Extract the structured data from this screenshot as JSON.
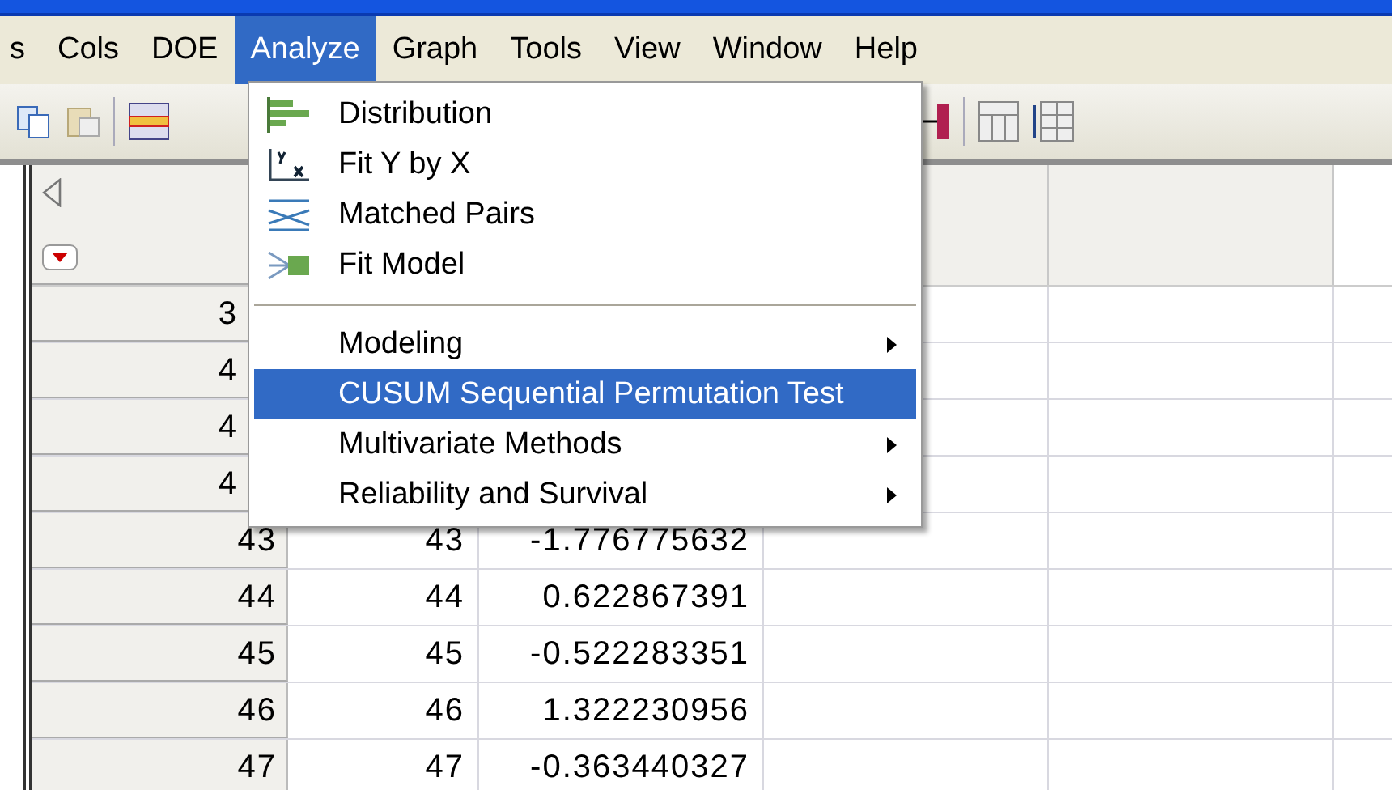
{
  "menubar": [
    {
      "label": "s",
      "selected": false
    },
    {
      "label": "Cols",
      "selected": false
    },
    {
      "label": "DOE",
      "selected": false
    },
    {
      "label": "Analyze",
      "selected": true
    },
    {
      "label": "Graph",
      "selected": false
    },
    {
      "label": "Tools",
      "selected": false
    },
    {
      "label": "View",
      "selected": false
    },
    {
      "label": "Window",
      "selected": false
    },
    {
      "label": "Help",
      "selected": false
    }
  ],
  "menu": {
    "items": [
      {
        "kind": "tool",
        "label": "Distribution",
        "selected": false
      },
      {
        "kind": "tool",
        "label": "Fit Y by X",
        "selected": false
      },
      {
        "kind": "tool",
        "label": "Matched Pairs",
        "selected": false
      },
      {
        "kind": "tool",
        "label": "Fit Model",
        "selected": false
      },
      {
        "kind": "separator"
      },
      {
        "kind": "submenu",
        "label": "Modeling",
        "selected": false
      },
      {
        "kind": "item",
        "label": "CUSUM Sequential Permutation Test",
        "selected": true
      },
      {
        "kind": "submenu",
        "label": "Multivariate Methods",
        "selected": false
      },
      {
        "kind": "submenu",
        "label": "Reliability and Survival",
        "selected": false
      }
    ]
  },
  "table": {
    "rows": [
      {
        "row": "3",
        "covered": true
      },
      {
        "row": "4",
        "covered": true
      },
      {
        "row": "4",
        "covered": true
      },
      {
        "row": "4",
        "covered": true
      },
      {
        "row": "43",
        "covered": false,
        "cells": [
          "43",
          "-1.776775632"
        ]
      },
      {
        "row": "44",
        "covered": false,
        "cells": [
          "44",
          "0.622867391"
        ]
      },
      {
        "row": "45",
        "covered": false,
        "cells": [
          "45",
          "-0.522283351"
        ]
      },
      {
        "row": "46",
        "covered": false,
        "cells": [
          "46",
          "1.322230956"
        ]
      },
      {
        "row": "47",
        "covered": false,
        "cells": [
          "47",
          "-0.363440327"
        ]
      }
    ]
  }
}
